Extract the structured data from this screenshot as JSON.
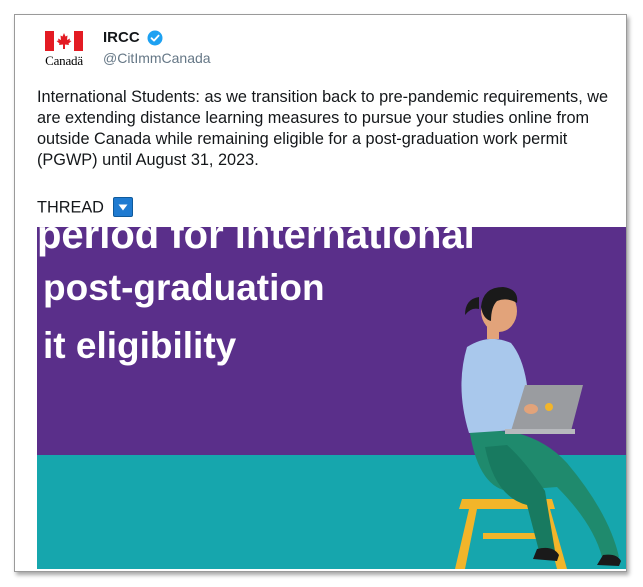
{
  "account": {
    "display_name": "IRCC",
    "handle": "@CitImmCanada",
    "logo_wordmark": "Canadä",
    "verified": true
  },
  "tweet": {
    "text": "International Students: as we transition back to pre-pandemic requirements, we are extending distance learning measures to pursue your studies online from outside Canada while remaining eligible for a post-graduation work permit (PGWP) until August 31, 2023.",
    "thread_label": "THREAD",
    "thread_icon": "down-arrow-button-icon"
  },
  "media": {
    "cut_line": "period for international",
    "line1": "post-graduation",
    "line2": "it eligibility",
    "colors": {
      "top": "#5a2f8a",
      "bottom": "#16a6ad"
    }
  },
  "colors": {
    "flag_red": "#e31b23",
    "verified_blue": "#1da1f2",
    "thread_icon_blue": "#1f7bd1"
  }
}
